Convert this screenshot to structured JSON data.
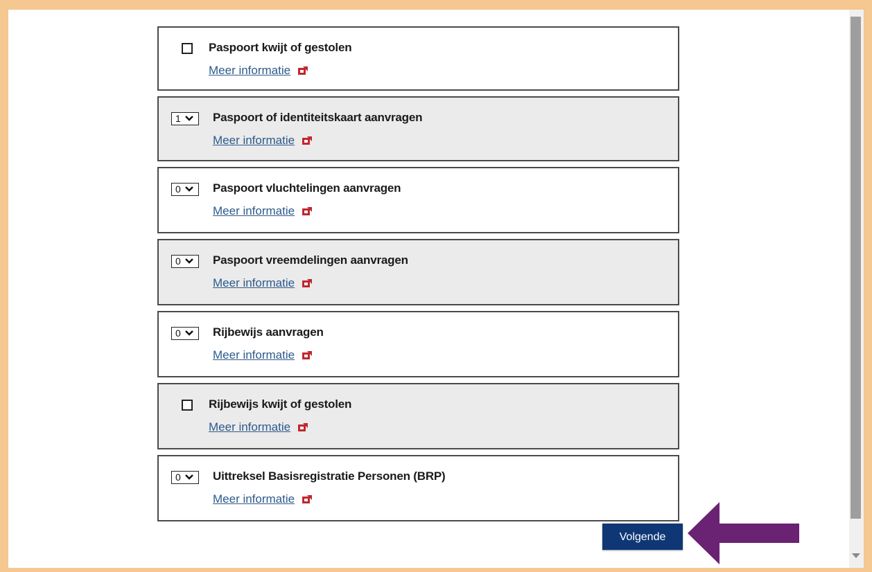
{
  "items": [
    {
      "type": "checkbox",
      "title": "Paspoort kwijt of gestolen",
      "link": "Meer informatie"
    },
    {
      "type": "select",
      "value": "1",
      "title": "Paspoort of identiteitskaart aanvragen",
      "link": "Meer informatie"
    },
    {
      "type": "select",
      "value": "0",
      "title": "Paspoort vluchtelingen aanvragen",
      "link": "Meer informatie"
    },
    {
      "type": "select",
      "value": "0",
      "title": "Paspoort vreemdelingen aanvragen",
      "link": "Meer informatie"
    },
    {
      "type": "select",
      "value": "0",
      "title": "Rijbewijs aanvragen",
      "link": "Meer informatie"
    },
    {
      "type": "checkbox",
      "title": "Rijbewijs kwijt of gestolen",
      "link": "Meer informatie"
    },
    {
      "type": "select",
      "value": "0",
      "title": "Uittreksel Basisregistratie Personen (BRP)",
      "link": "Meer informatie"
    }
  ],
  "next_button": "Volgende",
  "colors": {
    "frame": "#f4c890",
    "row_alt": "#ebebeb",
    "link": "#2c5a8c",
    "button": "#0f3775",
    "arrow": "#6a2272",
    "icon": "#c0272d"
  }
}
